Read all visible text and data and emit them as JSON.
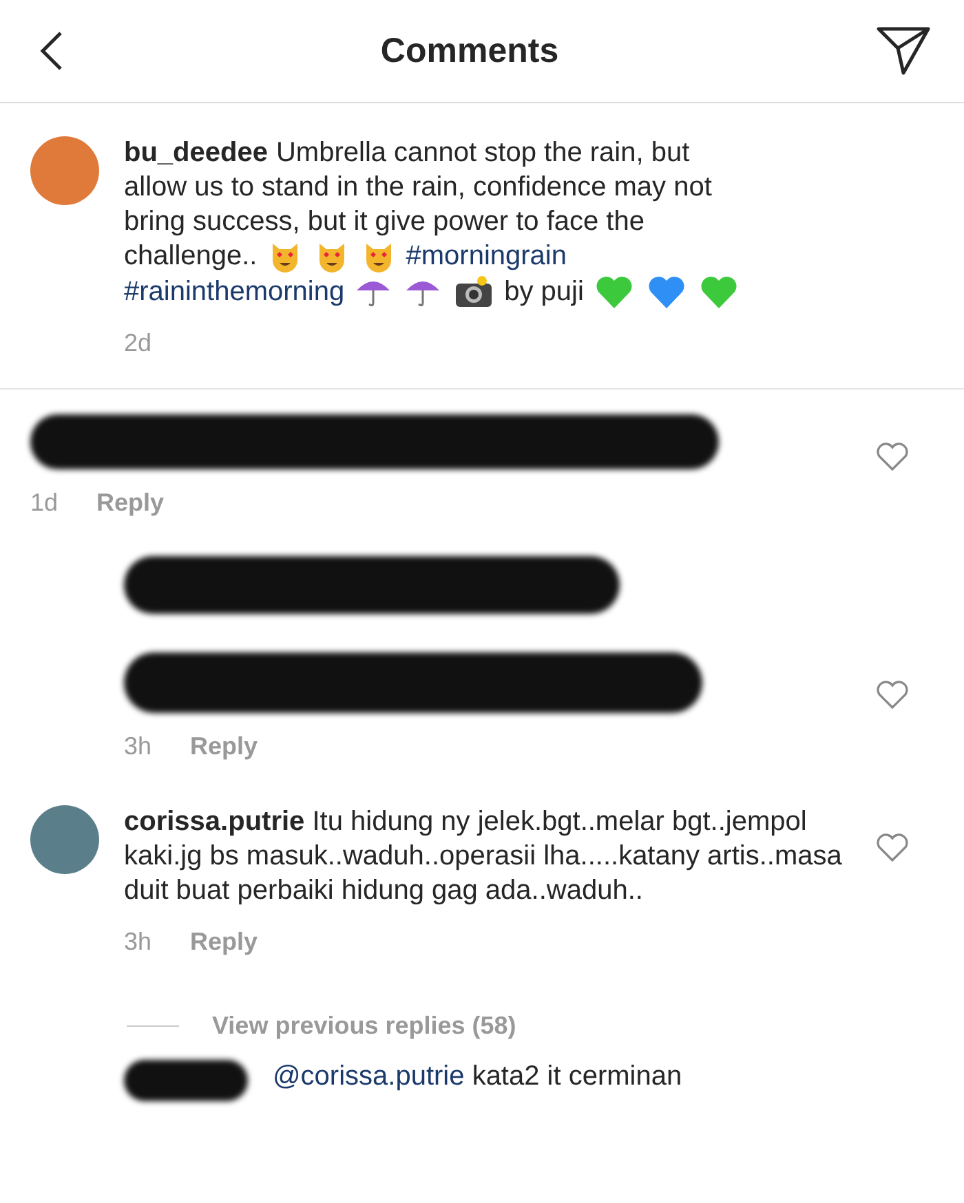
{
  "header": {
    "title": "Comments"
  },
  "caption": {
    "username": "bu_deedee",
    "lines": [
      [
        {
          "kind": "text",
          "text": "Umbrella cannot stop the rain, but"
        }
      ],
      [
        {
          "kind": "text",
          "text": "allow us to stand in the rain, confidence may not"
        }
      ],
      [
        {
          "kind": "text",
          "text": "bring success, but it give power to face the"
        }
      ],
      [
        {
          "kind": "text",
          "text": "challenge.."
        },
        {
          "kind": "cat"
        },
        {
          "kind": "cat"
        },
        {
          "kind": "cat"
        },
        {
          "kind": "hashtag",
          "text": "#morningrain"
        }
      ],
      [
        {
          "kind": "hashtag",
          "text": "#raininthemorning"
        },
        {
          "kind": "umbrella"
        },
        {
          "kind": "umbrella"
        },
        {
          "kind": "camera"
        },
        {
          "kind": "text",
          "text": "by puji"
        },
        {
          "kind": "heart",
          "color": "#3cc93c"
        },
        {
          "kind": "heart",
          "color": "#2f8ff5"
        },
        {
          "kind": "heart",
          "color": "#3cc93c"
        }
      ]
    ],
    "time": "2d"
  },
  "comments": [
    {
      "kind": "redacted",
      "time": "1d",
      "reply": "Reply",
      "liked": false,
      "replies": [
        {
          "kind": "redacted-input"
        },
        {
          "kind": "redacted",
          "time": "3h",
          "reply": "Reply",
          "liked": false
        }
      ]
    },
    {
      "kind": "comment",
      "username": "corissa.putrie",
      "text": "Itu hidung ny jelek.bgt..melar bgt..jempol kaki.jg bs masuk..waduh..operasii lha.....katany artis..masa duit buat perbaiki hidung gag ada..waduh..",
      "time": "3h",
      "reply": "Reply",
      "liked": false,
      "view_replies": "View previous replies (58)",
      "replies": [
        {
          "kind": "partial",
          "mention": "@corissa.putrie",
          "text": "kata2 it cerminan"
        }
      ]
    }
  ]
}
